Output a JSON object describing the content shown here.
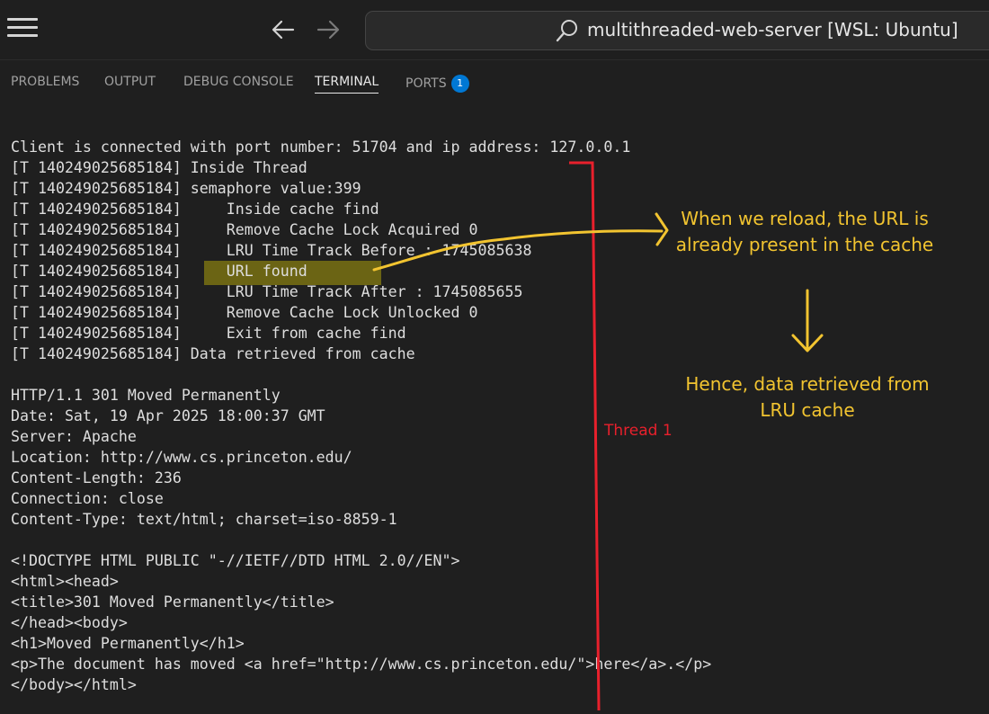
{
  "titlebar": {
    "command_center_text": "multithreaded-web-server [WSL: Ubuntu]"
  },
  "panel": {
    "tabs": [
      {
        "label": "PROBLEMS"
      },
      {
        "label": "OUTPUT"
      },
      {
        "label": "DEBUG CONSOLE"
      },
      {
        "label": "TERMINAL",
        "active": true
      },
      {
        "label": "PORTS",
        "badge": "1"
      }
    ]
  },
  "terminal": {
    "lines": [
      "Client is connected with port number: 51704 and ip address: 127.0.0.1",
      "[T 140249025685184] Inside Thread",
      "[T 140249025685184] semaphore value:399",
      "[T 140249025685184]     Inside cache find",
      "[T 140249025685184]     Remove Cache Lock Acquired 0",
      "[T 140249025685184]     LRU Time Track Before : 1745085638",
      "[T 140249025685184]     URL found",
      "[T 140249025685184]     LRU Time Track After : 1745085655",
      "[T 140249025685184]     Remove Cache Lock Unlocked 0",
      "[T 140249025685184]     Exit from cache find",
      "[T 140249025685184] Data retrieved from cache",
      "",
      "HTTP/1.1 301 Moved Permanently",
      "Date: Sat, 19 Apr 2025 18:00:37 GMT",
      "Server: Apache",
      "Location: http://www.cs.princeton.edu/",
      "Content-Length: 236",
      "Connection: close",
      "Content-Type: text/html; charset=iso-8859-1",
      "",
      "<!DOCTYPE HTML PUBLIC \"-//IETF//DTD HTML 2.0//EN\">",
      "<html><head>",
      "<title>301 Moved Permanently</title>",
      "</head><body>",
      "<h1>Moved Permanently</h1>",
      "<p>The document has moved <a href=\"http://www.cs.princeton.edu/\">here</a>.</p>",
      "</body></html>"
    ]
  },
  "annotations": {
    "cache_note": "When we reload, the URL is already present in the cache",
    "result_note": "Hence, data retrieved from LRU cache",
    "thread_label": "Thread 1"
  },
  "colors": {
    "annotation": "#f2c430",
    "thread_line": "#e8202c",
    "highlight": "#6b6414",
    "badge": "#0078d4"
  }
}
